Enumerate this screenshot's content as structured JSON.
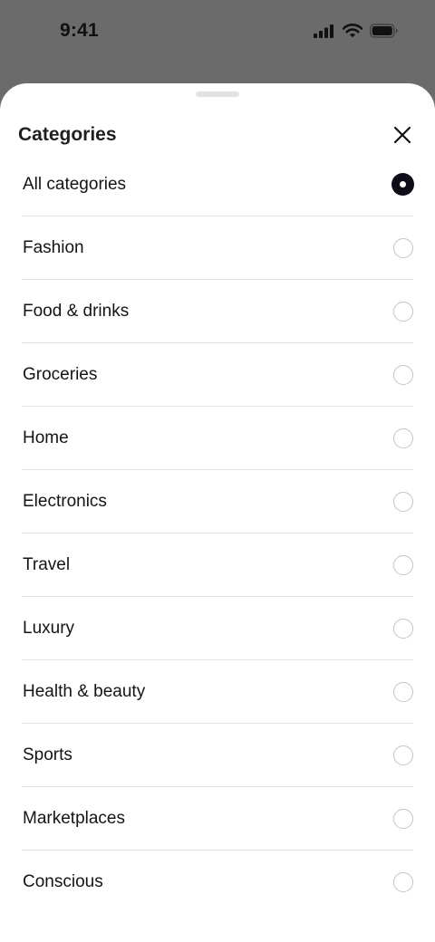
{
  "status_bar": {
    "time": "9:41",
    "icons": [
      "cellular-signal-icon",
      "wifi-icon",
      "battery-icon"
    ]
  },
  "sheet": {
    "title": "Categories",
    "close_icon": "close-icon",
    "selected_index": 0,
    "options": [
      {
        "label": "All categories",
        "selected": true
      },
      {
        "label": "Fashion",
        "selected": false
      },
      {
        "label": "Food & drinks",
        "selected": false
      },
      {
        "label": "Groceries",
        "selected": false
      },
      {
        "label": "Home",
        "selected": false
      },
      {
        "label": "Electronics",
        "selected": false
      },
      {
        "label": "Travel",
        "selected": false
      },
      {
        "label": "Luxury",
        "selected": false
      },
      {
        "label": "Health & beauty",
        "selected": false
      },
      {
        "label": "Sports",
        "selected": false
      },
      {
        "label": "Marketplaces",
        "selected": false
      },
      {
        "label": "Conscious",
        "selected": false
      }
    ]
  },
  "colors": {
    "overlay": "#6b6b6b",
    "sheet_background": "#ffffff",
    "radio_selected": "#0d0d1a",
    "radio_border": "#c4c4c4",
    "divider": "#e4e4e4"
  }
}
